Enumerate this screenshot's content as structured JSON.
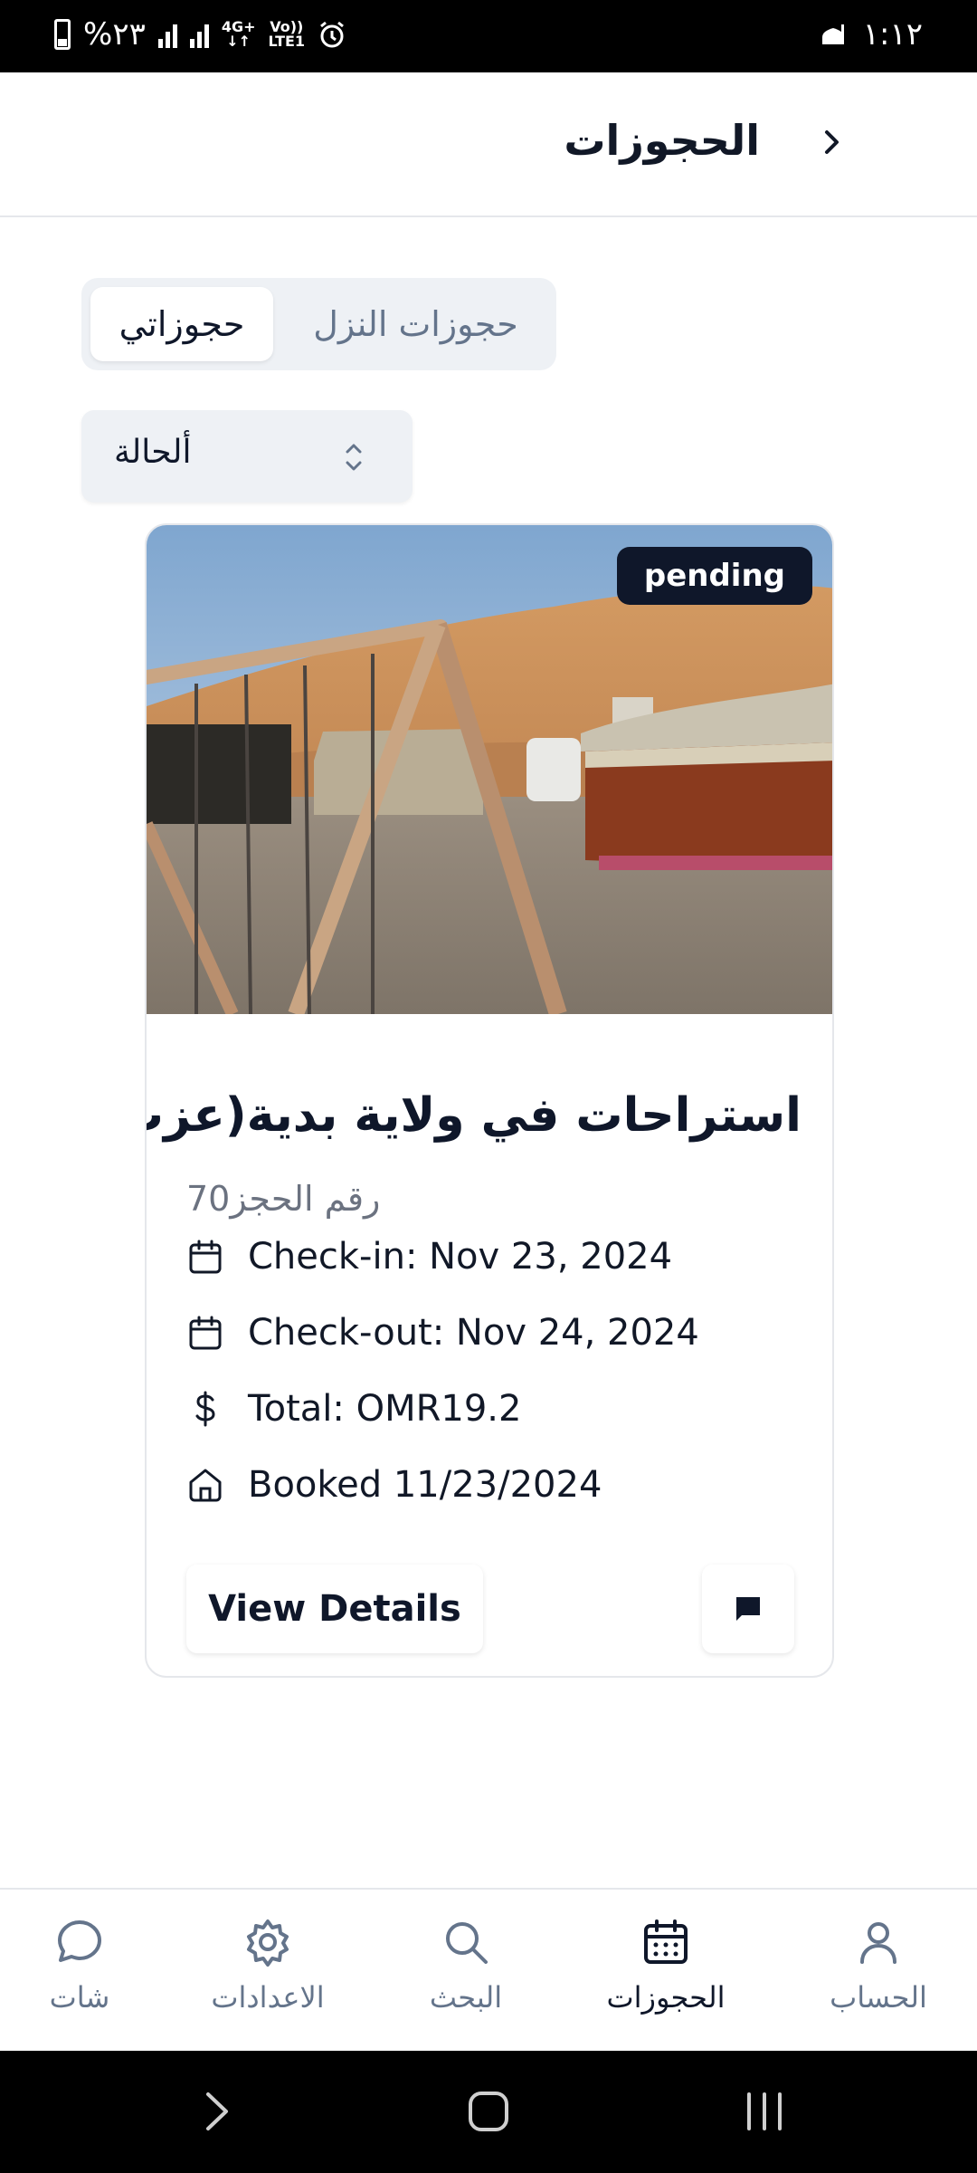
{
  "status_bar": {
    "battery_text": "%٢٣",
    "network_4g": "4G+",
    "network_volte": "Vo))",
    "network_lte": "LTE1",
    "time": "١:١٢"
  },
  "header": {
    "title": "الحجوزات"
  },
  "tabs": {
    "my_bookings": "حجوزاتي",
    "guest_bookings": "حجوزات النزل"
  },
  "status_filter": {
    "label": "ألحالة"
  },
  "booking": {
    "status_badge": "pending",
    "title": "استراحات في ولاية بدية(عزب)",
    "booking_number": "رقم الحجز70",
    "check_in": "Check-in: Nov 23, 2024",
    "check_out": "Check-out: Nov 24, 2024",
    "total": "Total: OMR19.2",
    "booked": "Booked 11/23/2024",
    "view_details": "View Details"
  },
  "bottom_nav": {
    "account": "الحساب",
    "bookings": "الحجوزات",
    "search": "البحث",
    "settings": "الاعدادات",
    "chat": "شات"
  },
  "colors": {
    "accent": "#0f172a",
    "muted": "#64748b",
    "tab_bg": "#eef1f5"
  }
}
